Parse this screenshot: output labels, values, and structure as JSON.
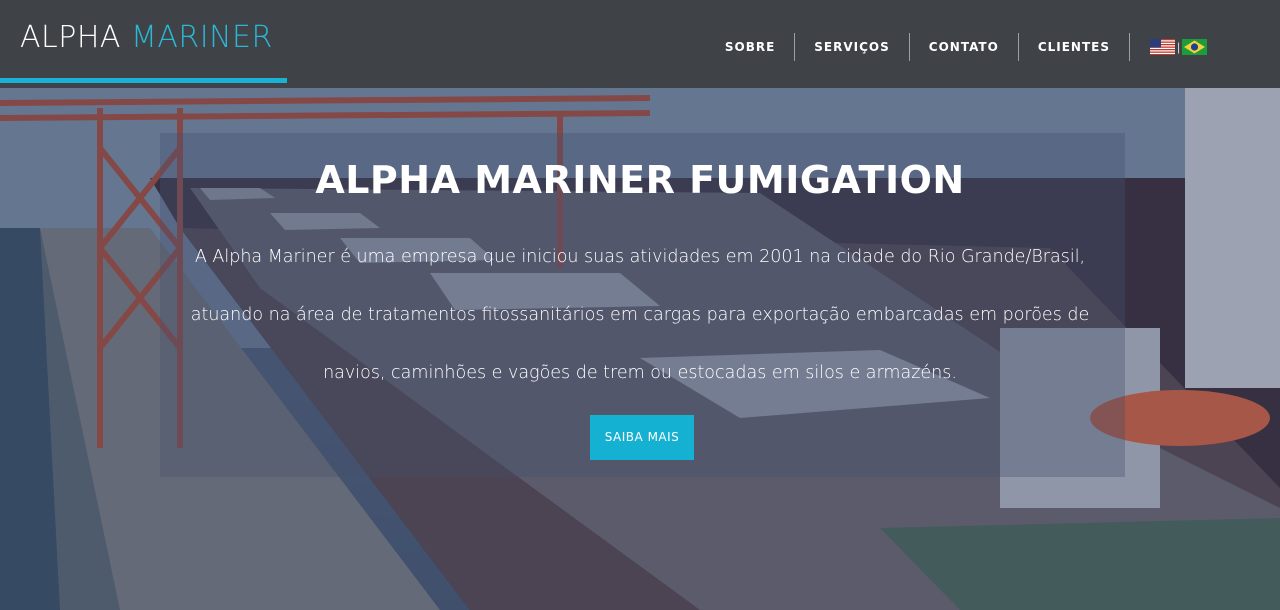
{
  "brand": {
    "word1": "ALPHA",
    "word2": "MARINER"
  },
  "nav": {
    "items": [
      {
        "label": "SOBRE"
      },
      {
        "label": "SERVIÇOS"
      },
      {
        "label": "CONTATO"
      },
      {
        "label": "CLIENTES"
      }
    ],
    "flag_separator": "|",
    "flags": [
      {
        "icon": "us-flag-icon"
      },
      {
        "icon": "brazil-flag-icon"
      }
    ]
  },
  "hero": {
    "title": "ALPHA MARINER FUMIGATION",
    "text": "A Alpha Mariner é uma empresa que iniciou suas atividades em 2001 na cidade do Rio Grande/Brasil, atuando na área de tratamentos fitossanitários em cargas para exportação embarcadas em porões de navios, caminhões e vagões de trem ou estocadas em silos e armazéns.",
    "button": "SAIBA MAIS"
  },
  "colors": {
    "accent": "#18b3d4",
    "header_bg": "#3f4347",
    "text": "#ffffff"
  }
}
